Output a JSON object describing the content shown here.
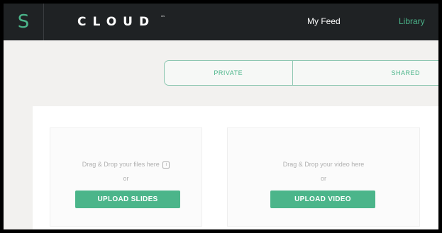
{
  "nav": {
    "logo_letter": "S",
    "brand": "CLOUD",
    "brand_mark": "™",
    "links": [
      "My Feed",
      "Library"
    ]
  },
  "tabs": [
    "PRIVATE",
    "SHARED"
  ],
  "uploads": {
    "slides": {
      "drop_text": "Drag & Drop your files here",
      "info_icon": "i",
      "or_text": "or",
      "button_label": "UPLOAD SLIDES"
    },
    "video": {
      "drop_text": "Drag & Drop your video here",
      "or_text": "or",
      "button_label": "UPLOAD VIDEO"
    }
  },
  "colors": {
    "accent": "#4bb58a",
    "navbar": "#1f2224",
    "background": "#f2f1ef"
  }
}
